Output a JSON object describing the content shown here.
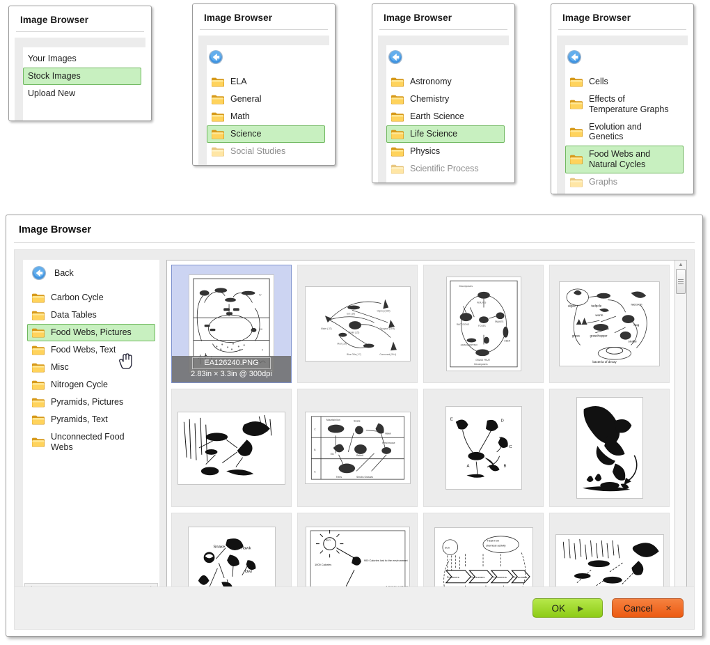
{
  "app": {
    "title": "Image Browser",
    "back_label": "Back"
  },
  "colors": {
    "selection_green_bg": "#c8f0c0",
    "selection_green_border": "#70b860",
    "thumb_selected_bg": "#ccd4f2",
    "thumb_selected_border": "#7f93cf",
    "ok_green": "#8dcb16",
    "cancel_orange": "#ec5a12",
    "panel_body_gray": "#ececec"
  },
  "panels": [
    {
      "title": "Image Browser",
      "has_back": false,
      "items": [
        {
          "label": "Your Images",
          "selected": false,
          "faded": false,
          "icon": "none"
        },
        {
          "label": "Stock Images",
          "selected": true,
          "faded": false,
          "icon": "none"
        },
        {
          "label": "Upload New",
          "selected": false,
          "faded": false,
          "icon": "none"
        }
      ]
    },
    {
      "title": "Image Browser",
      "has_back": true,
      "items": [
        {
          "label": "ELA",
          "selected": false,
          "faded": false,
          "icon": "folder-icon"
        },
        {
          "label": "General",
          "selected": false,
          "faded": false,
          "icon": "folder-icon"
        },
        {
          "label": "Math",
          "selected": false,
          "faded": false,
          "icon": "folder-icon"
        },
        {
          "label": "Science",
          "selected": true,
          "faded": false,
          "icon": "folder-icon"
        },
        {
          "label": "Social Studies",
          "selected": false,
          "faded": true,
          "icon": "folder-icon"
        }
      ]
    },
    {
      "title": "Image Browser",
      "has_back": true,
      "items": [
        {
          "label": "Astronomy",
          "selected": false,
          "faded": false,
          "icon": "folder-icon"
        },
        {
          "label": "Chemistry",
          "selected": false,
          "faded": false,
          "icon": "folder-icon"
        },
        {
          "label": "Earth Science",
          "selected": false,
          "faded": false,
          "icon": "folder-icon"
        },
        {
          "label": "Life Science",
          "selected": true,
          "faded": false,
          "icon": "folder-icon"
        },
        {
          "label": "Physics",
          "selected": false,
          "faded": false,
          "icon": "folder-icon"
        },
        {
          "label": "Scientific Process",
          "selected": false,
          "faded": true,
          "icon": "folder-icon"
        }
      ]
    },
    {
      "title": "Image Browser",
      "has_back": true,
      "items": [
        {
          "label": "Cells",
          "selected": false,
          "faded": false,
          "icon": "folder-icon"
        },
        {
          "label": "Effects of\nTemperature Graphs",
          "selected": false,
          "faded": false,
          "icon": "folder-icon"
        },
        {
          "label": "Evolution and\nGenetics",
          "selected": false,
          "faded": false,
          "icon": "folder-icon"
        },
        {
          "label": "Food Webs and\nNatural Cycles",
          "selected": true,
          "faded": false,
          "icon": "folder-icon"
        },
        {
          "label": "Graphs",
          "selected": false,
          "faded": true,
          "icon": "folder-icon"
        }
      ]
    }
  ],
  "dialog": {
    "title": "Image Browser",
    "back_label": "Back",
    "sidebar": [
      {
        "label": "Carbon Cycle",
        "selected": false
      },
      {
        "label": "Data Tables",
        "selected": false
      },
      {
        "label": "Food Webs, Pictures",
        "selected": true
      },
      {
        "label": "Food Webs, Text",
        "selected": false
      },
      {
        "label": "Misc",
        "selected": false
      },
      {
        "label": "Nitrogen Cycle",
        "selected": false
      },
      {
        "label": "Pyramids, Pictures",
        "selected": false
      },
      {
        "label": "Pyramids, Text",
        "selected": false
      },
      {
        "label": "Unconnected Food\nWebs",
        "selected": false
      }
    ],
    "thumbnails": [
      {
        "id": "t1",
        "selected": true,
        "art": "aquatic-food-web",
        "filename": "EA126240.PNG",
        "dimensions": "2.83in × 3.3in @ 300dpi"
      },
      {
        "id": "t2",
        "selected": false,
        "art": "pond-food-web",
        "filename": "",
        "dimensions": ""
      },
      {
        "id": "t3",
        "selected": false,
        "art": "circular-food-web",
        "filename": "",
        "dimensions": ""
      },
      {
        "id": "t4",
        "selected": false,
        "art": "labeled-pond-web",
        "filename": "",
        "dimensions": ""
      },
      {
        "id": "t5",
        "selected": false,
        "art": "hawk-grass-web",
        "filename": "",
        "dimensions": ""
      },
      {
        "id": "t6",
        "selected": false,
        "art": "abc-tier-web",
        "filename": "",
        "dimensions": ""
      },
      {
        "id": "t7",
        "selected": false,
        "art": "letters-abcde-web",
        "filename": "",
        "dimensions": ""
      },
      {
        "id": "t8",
        "selected": false,
        "art": "owl-hunting",
        "filename": "",
        "dimensions": ""
      },
      {
        "id": "t9",
        "selected": false,
        "art": "snake-hawk-owl-web",
        "filename": "",
        "dimensions": ""
      },
      {
        "id": "t10",
        "selected": false,
        "art": "sun-calories-chain",
        "filename": "",
        "dimensions": ""
      },
      {
        "id": "t11",
        "selected": false,
        "art": "producer-consumer-flow",
        "filename": "",
        "dimensions": ""
      },
      {
        "id": "t12",
        "selected": false,
        "art": "marsh-scene-web",
        "filename": "",
        "dimensions": ""
      }
    ],
    "scrollbars": {
      "vertical_up": "▲",
      "vertical_down": "▼",
      "horizontal_left": "◀",
      "horizontal_right": "▶"
    },
    "buttons": {
      "ok": {
        "label": "OK",
        "glyph": "▶"
      },
      "cancel": {
        "label": "Cancel",
        "glyph": "✕"
      }
    }
  }
}
